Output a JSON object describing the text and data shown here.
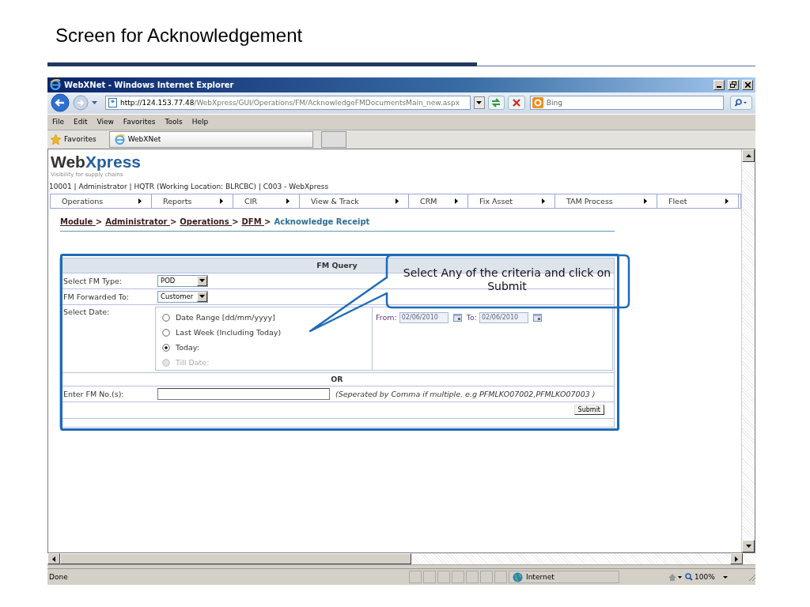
{
  "slide": {
    "title": "Screen for Acknowledgement"
  },
  "window": {
    "title": "WebXNet - Windows Internet Explorer"
  },
  "address_bar": {
    "url_host": "http://124.153.77.48",
    "url_path": "/WebXpress/GUI/Operations/FM/AcknowledgeFMDocumentsMain_new.aspx",
    "search_placeholder": "Bing"
  },
  "menu_bar": [
    "File",
    "Edit",
    "View",
    "Favorites",
    "Tools",
    "Help"
  ],
  "favorites_bar": {
    "label": "Favorites",
    "tab": "WebXNet"
  },
  "page": {
    "logo": {
      "part_1": "Web",
      "part_2": "Xpress"
    },
    "tagline": "Visibility for supply chains",
    "user_info": "10001 | Administrator | HQTR (Working Location: BLRCBC) | C003 - WebXpress",
    "nav_menu": [
      {
        "label": "Operations"
      },
      {
        "label": "Reports"
      },
      {
        "label": "CIR"
      },
      {
        "label": "View & Track"
      },
      {
        "label": "CRM"
      },
      {
        "label": "Fix Asset"
      },
      {
        "label": "TAM Process"
      },
      {
        "label": "Fleet"
      }
    ],
    "breadcrumb": [
      {
        "label": "Module ",
        "link": true,
        "separator": ">"
      },
      {
        "label": "Administrator ",
        "link": true,
        "separator": ">"
      },
      {
        "label": "Operations ",
        "link": true,
        "separator": ">"
      },
      {
        "label": "DFM ",
        "link": true,
        "separator": ">"
      },
      {
        "label": "Acknowledge Receipt",
        "link": false
      }
    ]
  },
  "form": {
    "title": "FM Query",
    "fields": [
      {
        "kind": "select",
        "label": "Select FM Type:",
        "value": "POD"
      },
      {
        "kind": "select",
        "label": "FM Forwarded To:",
        "value": "Customer"
      }
    ],
    "date": {
      "label": "Select Date:",
      "options": [
        {
          "label": "Date Range [dd/mm/yyyy]",
          "selected": false,
          "disabled": false
        },
        {
          "label": "Last Week (Including Today)",
          "selected": false,
          "disabled": false
        },
        {
          "label": "Today:",
          "selected": true,
          "disabled": false
        },
        {
          "label": "Till Date:",
          "selected": false,
          "disabled": true
        }
      ],
      "from": {
        "label": "From:",
        "value": "02/06/2010",
        "disabled": true
      },
      "to": {
        "label": "To:",
        "value": "02/06/2010",
        "disabled": true
      }
    },
    "separator": "OR",
    "fm_number": {
      "label": "Enter FM No.(s):",
      "hint": "(Seperated by Comma if multiple. e.g PFMLKO07002,PFMLKO07003 )"
    },
    "submit": "Submit"
  },
  "callout": {
    "text": "Select Any of the criteria and click on Submit"
  },
  "status_bar": {
    "text": "Done",
    "zone": "Internet",
    "zoom": "100%"
  }
}
